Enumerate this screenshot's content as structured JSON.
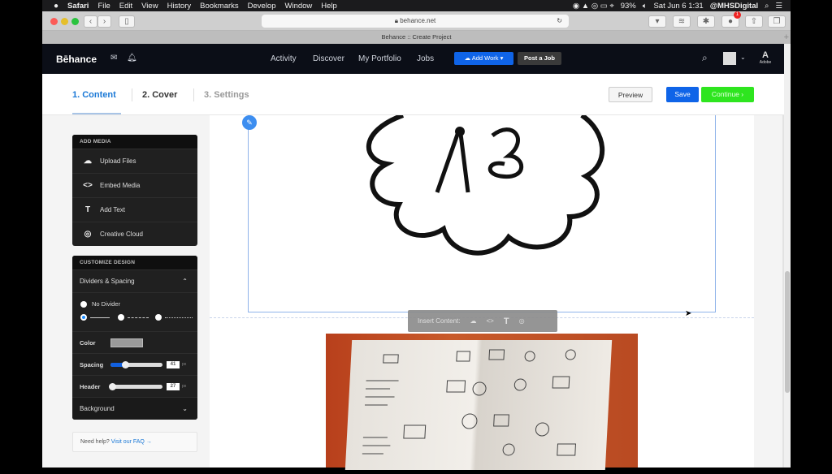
{
  "menubar": {
    "apple": "",
    "app": "Safari",
    "items": [
      "File",
      "Edit",
      "View",
      "History",
      "Bookmarks",
      "Develop",
      "Window",
      "Help"
    ],
    "battery": "93%",
    "datetime": "Sat Jun 6  1:31",
    "user": "@MHSDigital"
  },
  "browser": {
    "url": "behance.net",
    "tab_title": "Behance :: Create Project",
    "badge_count": "1"
  },
  "header": {
    "logo": "Bēhance",
    "nav": [
      "Activity",
      "Discover",
      "My Portfolio",
      "Jobs"
    ],
    "add_work": "Add Work",
    "post_job": "Post a Job",
    "adobe": "Adobe"
  },
  "steps": {
    "items": [
      "1. Content",
      "2. Cover",
      "3. Settings"
    ],
    "preview": "Preview",
    "save": "Save",
    "continue": "Continue"
  },
  "sidebar": {
    "add_media": {
      "title": "ADD MEDIA",
      "items": [
        "Upload Files",
        "Embed Media",
        "Add Text",
        "Creative Cloud"
      ]
    },
    "customize": {
      "title": "CUSTOMIZE DESIGN",
      "dividers": "Dividers & Spacing",
      "no_divider": "No Divider",
      "color_label": "Color",
      "color_value": "#9a9a9a",
      "spacing_label": "Spacing",
      "spacing_value": "41",
      "header_label": "Header",
      "header_value": "27",
      "unit": "px",
      "background": "Background"
    },
    "help": "Need help?",
    "faq": "Visit our FAQ →"
  },
  "insert": {
    "label": "Insert Content:"
  },
  "colors": {
    "accent": "#0e6fe0",
    "save": "#0f64e8",
    "continue": "#2ee51f",
    "header": "#0b0e17"
  }
}
